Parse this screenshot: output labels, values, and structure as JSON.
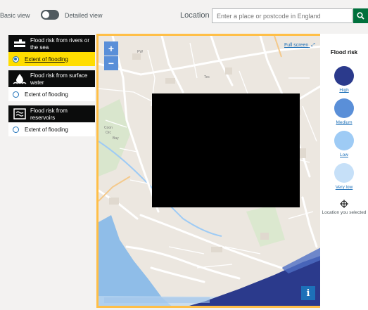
{
  "topbar": {
    "basic_view_label": "Basic view",
    "detailed_view_label": "Detailed view",
    "location_label": "Location",
    "location_placeholder": "Enter a place or postcode in England",
    "location_value": ""
  },
  "layers": [
    {
      "title": "Flood risk from rivers or the sea",
      "icon": "river-sea-icon",
      "option": "Extent of flooding",
      "selected": true
    },
    {
      "title": "Flood risk from surface water",
      "icon": "surface-water-icon",
      "option": "Extent of flooding",
      "selected": false
    },
    {
      "title": "Flood risk from reservoirs",
      "icon": "reservoir-icon",
      "option": "Extent of flooding",
      "selected": false
    }
  ],
  "map": {
    "zoom_in": "+",
    "zoom_out": "−",
    "full_screen_label": "Full screen",
    "info_label": "i",
    "street_labels": [
      "Coon",
      "Orc",
      "Bay",
      "Tes",
      "PW"
    ]
  },
  "legend": {
    "title": "Flood risk",
    "items": [
      {
        "label": "High",
        "color": "#2b3a8c"
      },
      {
        "label": "Medium",
        "color": "#5a8fd8"
      },
      {
        "label": "Low",
        "color": "#9ecbf5"
      },
      {
        "label": "Very low",
        "color": "#c6e0f8"
      }
    ],
    "location_selected_label": "Location you selected"
  },
  "colors": {
    "accent_yellow": "#ffbf47",
    "focus_yellow": "#ffdd00",
    "search_green": "#00703c",
    "link_blue": "#1d70b8",
    "sea_blue": "#8fbde8",
    "flood_high": "#2b3a8c"
  }
}
